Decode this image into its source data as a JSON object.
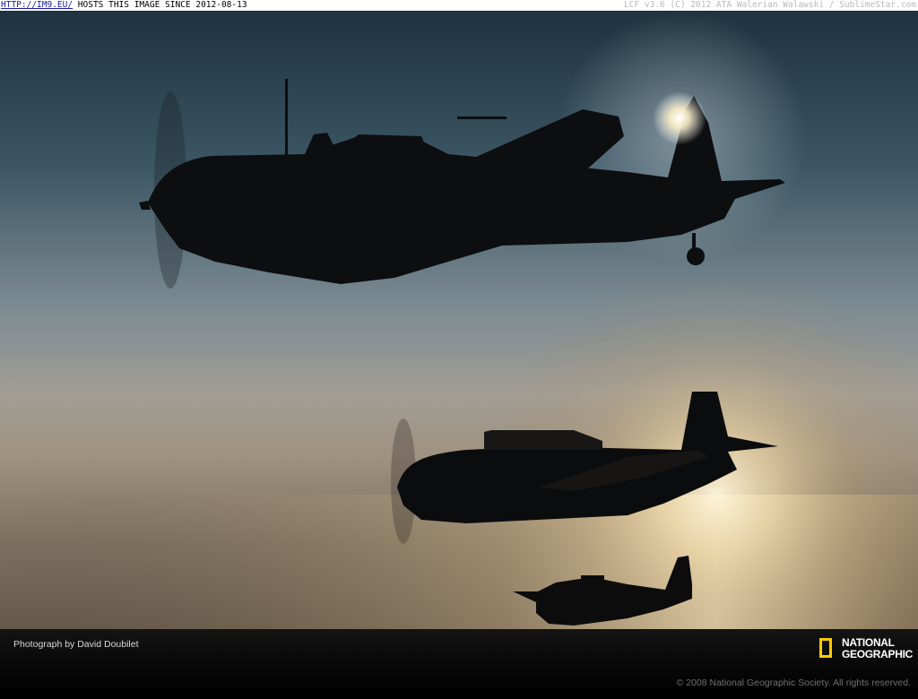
{
  "top_bar": {
    "link_text": "HTTP://IM9.EU/",
    "host_text": " HOSTS THIS IMAGE SINCE 2012-08-13",
    "right_text": "LCF v3.6 (C) 2012 ATA Walerian Walawski / SublimeStar.com"
  },
  "photo": {
    "description_icon": "aircraft-silhouettes-sunset"
  },
  "caption": {
    "credit": "Photograph by David Doubilet",
    "logo_line1": "NATIONAL",
    "logo_line2": "GEOGRAPHIC",
    "copyright": "© 2008 National Geographic Society. All rights reserved."
  },
  "colors": {
    "logo_yellow": "#ffcc00",
    "sky_top": "#1e3240",
    "sky_mid": "#7d8c94",
    "horizon_glow": "#f3e6c4"
  }
}
